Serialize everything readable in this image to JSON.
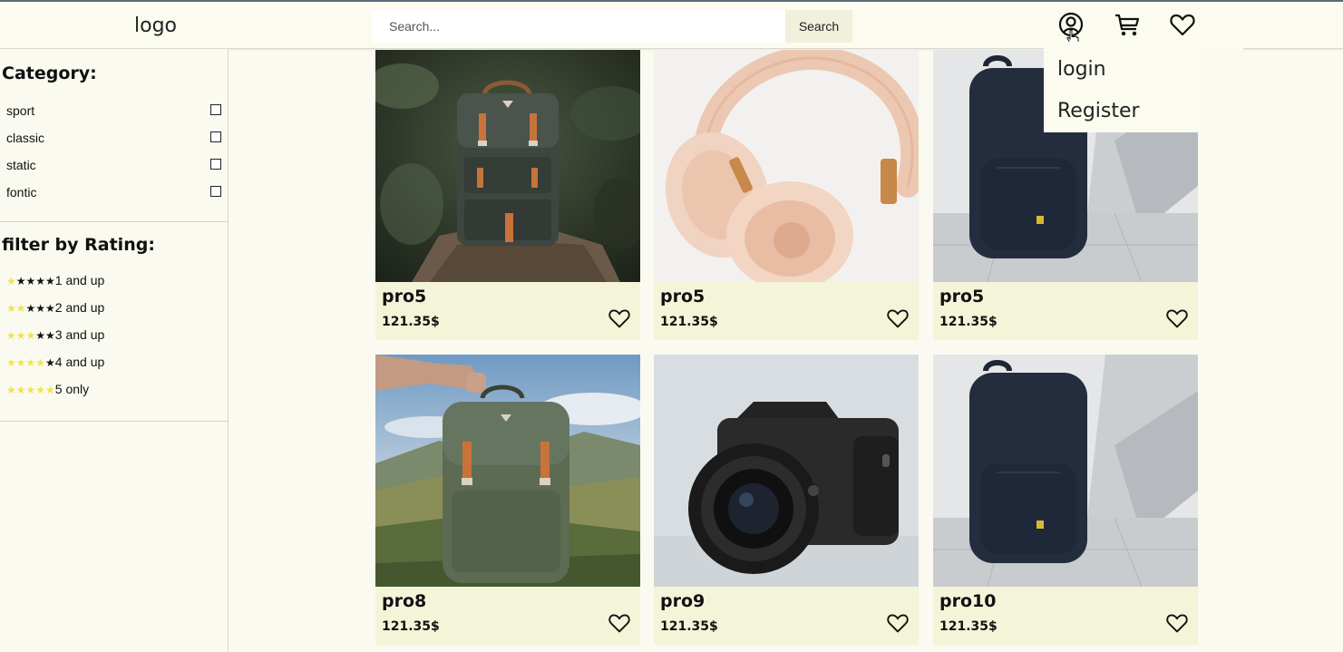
{
  "header": {
    "logo": "logo",
    "search_placeholder": "Search...",
    "search_button": "Search",
    "icons": [
      "user-icon",
      "cart-icon",
      "heart-icon"
    ]
  },
  "account_menu": {
    "items": [
      "login",
      "Register"
    ]
  },
  "sidebar": {
    "category_title": "Category:",
    "categories": [
      "sport",
      "classic",
      "static",
      "fontic"
    ],
    "rating_title": "filter by Rating:",
    "ratings": [
      {
        "filled": 1,
        "label": "1 and up"
      },
      {
        "filled": 2,
        "label": "2 and up"
      },
      {
        "filled": 3,
        "label": "3 and up"
      },
      {
        "filled": 4,
        "label": "4 and up"
      },
      {
        "filled": 5,
        "label": "5 only"
      }
    ]
  },
  "products": [
    {
      "name": "pro5",
      "price": "121.35$",
      "image": "green-backpack-on-rock"
    },
    {
      "name": "pro5",
      "price": "121.35$",
      "image": "beige-headphones"
    },
    {
      "name": "pro5",
      "price": "121.35$",
      "image": "navy-backpack"
    },
    {
      "name": "pro8",
      "price": "121.35$",
      "image": "green-backpack-held-outdoors"
    },
    {
      "name": "pro9",
      "price": "121.35$",
      "image": "nikon-camera"
    },
    {
      "name": "pro10",
      "price": "121.35$",
      "image": "navy-backpack"
    }
  ],
  "colors": {
    "background": "#fafaf0",
    "card": "#f4f4d8",
    "star_filled": "#f3e34a"
  }
}
